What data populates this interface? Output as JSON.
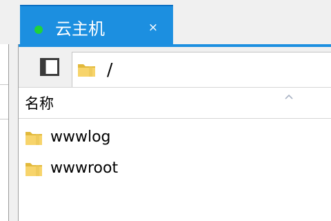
{
  "tab": {
    "title": "云主机",
    "close_glyph": "×",
    "status_color": "#1fd23b",
    "accent_color": "#1c8fe0"
  },
  "toolbar": {
    "toggle_icon": "panel-toggle-icon",
    "path_icon": "folder-icon",
    "path": "/"
  },
  "file_list": {
    "column_header": "名称",
    "sort_icon": "sort-ascending-icon",
    "items": [
      {
        "name": "wwwlog",
        "icon": "folder-icon"
      },
      {
        "name": "wwwroot",
        "icon": "folder-icon"
      }
    ]
  }
}
